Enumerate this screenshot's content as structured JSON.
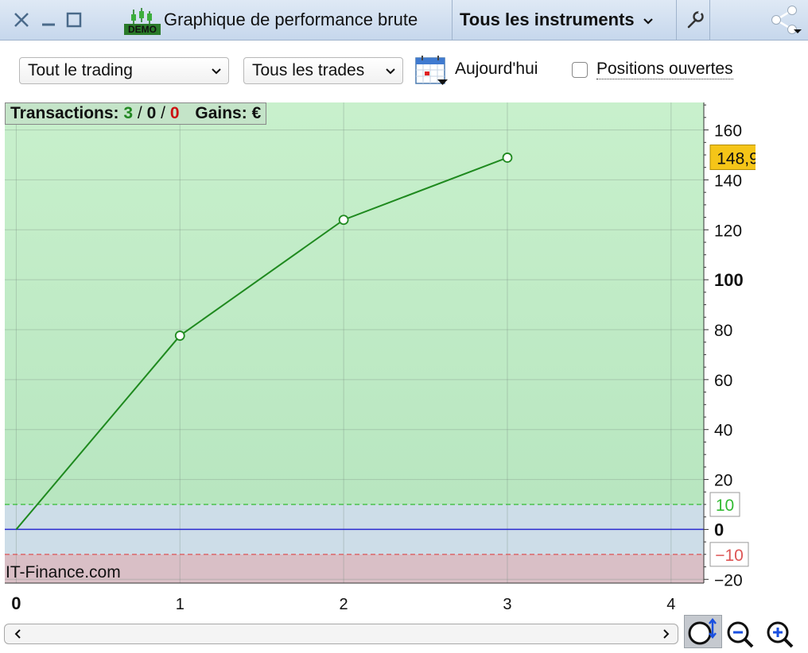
{
  "window": {
    "title": "Graphique de performance brute",
    "demo_badge": "DEMO",
    "instrument_selector": "Tous les instruments"
  },
  "toolbar": {
    "trading_filter": "Tout le trading",
    "trade_filter": "Tous les trades",
    "date_label": "Aujourd'hui",
    "open_positions_label": "Positions ouvertes",
    "open_positions_checked": false
  },
  "info": {
    "transactions_label": "Transactions:",
    "count_winning": "3",
    "separator": "/",
    "count_neutral": "0",
    "count_losing": "0",
    "gains_label": "Gains:",
    "gains_currency": "€"
  },
  "watermark": "IT-Finance.com",
  "chart_data": {
    "type": "line",
    "x": [
      0,
      1,
      2,
      3
    ],
    "y": [
      0,
      77.6,
      124,
      148.9
    ],
    "xlim": [
      -0.07,
      4.2
    ],
    "ylim": [
      -21.5,
      171
    ],
    "x_ticks": [
      "0",
      "1",
      "2",
      "3",
      "4"
    ],
    "y_ticks": [
      "-20",
      "0",
      "20",
      "40",
      "60",
      "80",
      "100",
      "120",
      "140",
      "160"
    ],
    "current_value_label": "148,9",
    "upper_threshold": 10,
    "upper_threshold_label": "10",
    "lower_threshold": -10,
    "lower_threshold_label": "-10",
    "grid": true,
    "colors": {
      "line": "#1f8a1f",
      "profit_zone": "#b8e6c0",
      "neutral_zone": "#cddde8",
      "loss_zone": "#d9bfc6",
      "zero_line": "#2a2ad0",
      "current_value_badge": "#f5c518",
      "upper_threshold": "#33bb33",
      "lower_threshold": "#dd5555"
    }
  }
}
